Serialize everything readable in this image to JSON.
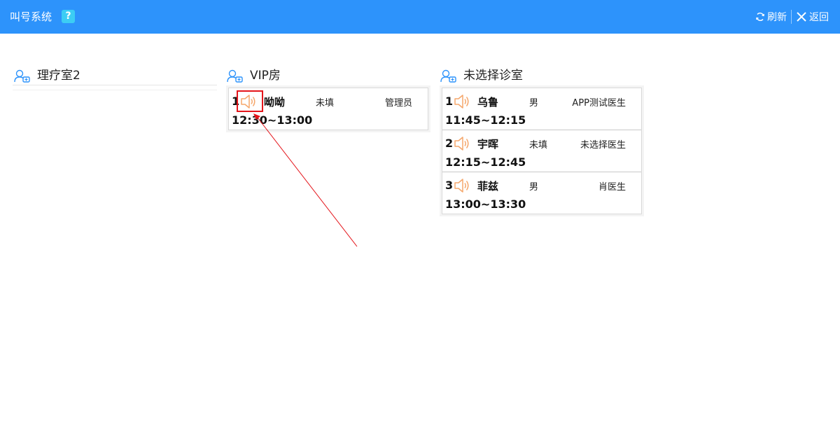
{
  "header": {
    "title": "叫号系统",
    "help_label": "?",
    "refresh_label": "刷新",
    "back_label": "返回",
    "background_color": "#2d93fb"
  },
  "rooms": [
    {
      "name": "理疗室2",
      "patients": []
    },
    {
      "name": "VIP房",
      "patients": [
        {
          "number": "1",
          "name": "呦呦",
          "gender": "未填",
          "doctor": "管理员",
          "time": "12:30~13:00"
        }
      ]
    },
    {
      "name": "未选择诊室",
      "patients": [
        {
          "number": "1",
          "name": "乌鲁",
          "gender": "男",
          "doctor": "APP测试医生",
          "time": "11:45~12:15"
        },
        {
          "number": "2",
          "name": "宇晖",
          "gender": "未填",
          "doctor": "未选择医生",
          "time": "12:15~12:45"
        },
        {
          "number": "3",
          "name": "菲兹",
          "gender": "男",
          "doctor": "肖医生",
          "time": "13:00~13:30"
        }
      ]
    }
  ],
  "icons": {
    "help": "question-icon",
    "refresh": "refresh-icon",
    "back": "close-icon",
    "room": "user-room-icon",
    "call": "speaker-icon"
  },
  "annotation": {
    "color": "#e4151b"
  }
}
